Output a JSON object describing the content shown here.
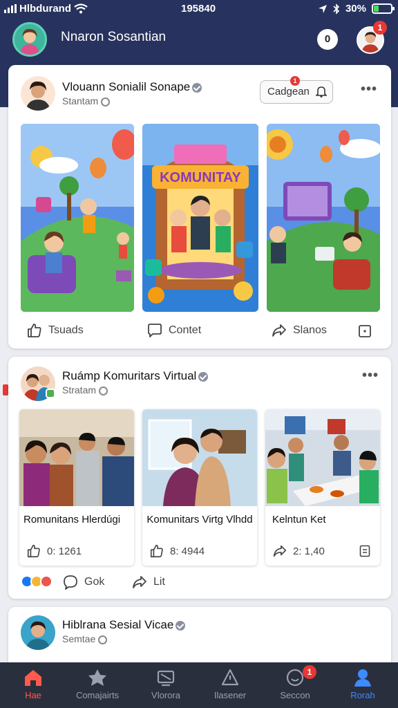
{
  "status_bar": {
    "carrier": "Hlbdurand",
    "time": "195840",
    "battery": "30%",
    "battery_level": 0.3
  },
  "header": {
    "name": "Nnaron Sosantian",
    "messages_label": "0",
    "notification_count": "1"
  },
  "posts": [
    {
      "title": "Vlouann Sonialil Sonape",
      "subtitle": "Stantam",
      "chip_label": "Cadgean",
      "chip_badge": "1",
      "poster_text": "KOMUNITAY",
      "actions": {
        "like": "Tsuads",
        "comment": "Contet",
        "share": "Slanos"
      }
    },
    {
      "title": "Ruámp Komuritars Virtual",
      "subtitle": "Stratam",
      "items": [
        {
          "caption": "Romunitans Hlerdúgi",
          "stat": "0: 1261"
        },
        {
          "caption": "Komunitars Virtg Vlhdd",
          "stat": "8: 4944"
        },
        {
          "caption": "Kelntun Ket",
          "stat": "2: 1,40"
        }
      ],
      "actions": {
        "like": "Gok",
        "share": "Lit"
      }
    },
    {
      "title": "Hiblrana Sesial Vicae",
      "subtitle": "Semtae"
    }
  ],
  "bottom_nav": {
    "items": [
      {
        "label": "Hae",
        "icon": "home-icon"
      },
      {
        "label": "Comajairts",
        "icon": "communities-icon"
      },
      {
        "label": "Vlorora",
        "icon": "video-icon"
      },
      {
        "label": "Ilasener",
        "icon": "marketplace-icon"
      },
      {
        "label": "Seccon",
        "icon": "notifications-icon",
        "badge": "1"
      },
      {
        "label": "Rorah",
        "icon": "profile-icon"
      }
    ]
  },
  "colors": {
    "header": "#27335e",
    "nav": "#2a2f3e",
    "active_red": "#ff5a4c",
    "active_blue": "#3d8bff",
    "badge": "#e53935"
  }
}
